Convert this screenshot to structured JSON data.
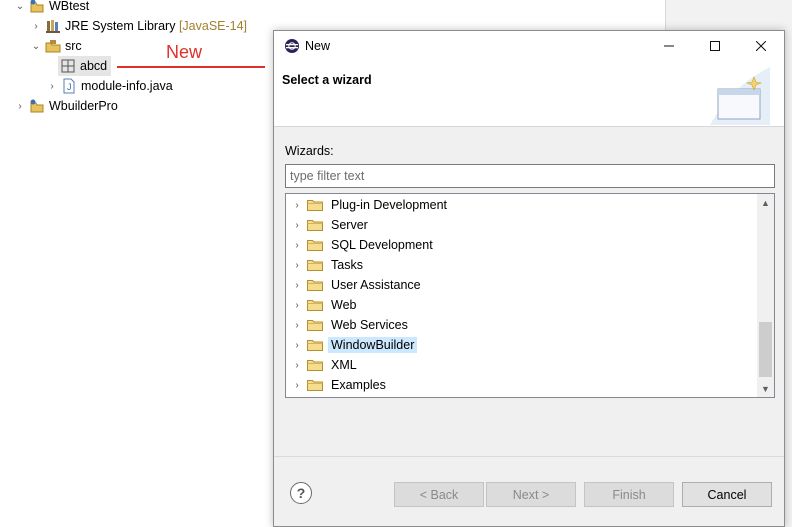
{
  "explorer": {
    "items": [
      {
        "label": "WBtest",
        "decoration": "",
        "level": 0,
        "expanded": true,
        "icon": "java-project-icon"
      },
      {
        "label": "JRE System Library",
        "decoration": "[JavaSE-14]",
        "level": 1,
        "expanded": false,
        "icon": "library-icon"
      },
      {
        "label": "src",
        "decoration": "",
        "level": 1,
        "expanded": true,
        "icon": "source-folder-icon"
      },
      {
        "label": "abcd",
        "decoration": "",
        "level": 2,
        "expanded": null,
        "icon": "package-icon",
        "selected": true
      },
      {
        "label": "module-info.java",
        "decoration": "",
        "level": 2,
        "expanded": false,
        "icon": "java-file-icon"
      },
      {
        "label": "WbuilderPro",
        "decoration": "",
        "level": 0,
        "expanded": false,
        "icon": "java-project-icon"
      }
    ]
  },
  "annotation": {
    "text": "New",
    "color": "#e0302a"
  },
  "dialog": {
    "title": "New",
    "banner_title": "Select a wizard",
    "wizards_label": "Wizards:",
    "filter_placeholder": "type filter text",
    "wizard_items": [
      {
        "label": "Plug-in Development",
        "selected": false
      },
      {
        "label": "Server",
        "selected": false
      },
      {
        "label": "SQL Development",
        "selected": false
      },
      {
        "label": "Tasks",
        "selected": false
      },
      {
        "label": "User Assistance",
        "selected": false
      },
      {
        "label": "Web",
        "selected": false
      },
      {
        "label": "Web Services",
        "selected": false
      },
      {
        "label": "WindowBuilder",
        "selected": true
      },
      {
        "label": "XML",
        "selected": false
      },
      {
        "label": "Examples",
        "selected": false
      }
    ],
    "buttons": {
      "back": "< Back",
      "next": "Next >",
      "finish": "Finish",
      "cancel": "Cancel"
    },
    "selection_color": "#cce8ff"
  }
}
